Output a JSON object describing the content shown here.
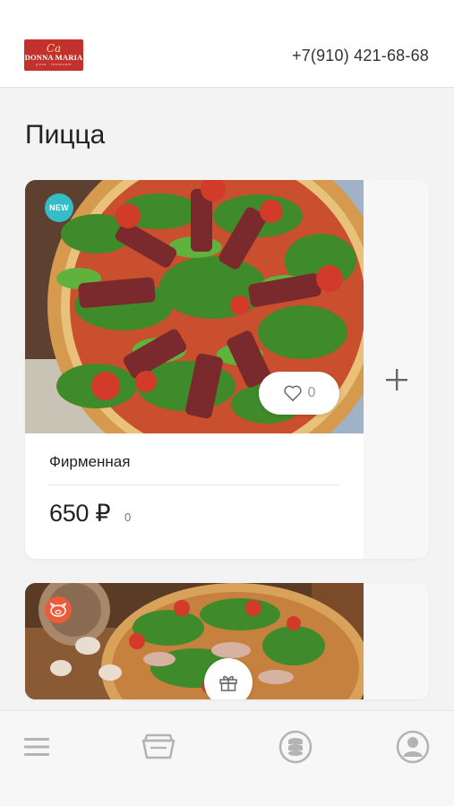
{
  "header": {
    "logo": {
      "top": "Сa",
      "name": "DONNA MARIA",
      "sub": "pizza · restaurant"
    },
    "phone": "+7(910) 421-68-68"
  },
  "page": {
    "title": "Пицца"
  },
  "products": [
    {
      "name": "Фирменная",
      "price": "650 ₽",
      "bonus": "0",
      "likes": "0",
      "badge": "NEW",
      "image": "pizza-arugula-bresaola-image"
    },
    {
      "badge": "pig-icon",
      "image": "pizza-ham-mushrooms-image"
    }
  ],
  "tabbar": {
    "items": [
      "menu-icon",
      "basket-icon",
      "bonus-coins-icon",
      "profile-icon"
    ]
  },
  "colors": {
    "brand": "#c4302b",
    "new_badge": "#35bdc7",
    "pig_badge": "#ec5b3b",
    "background": "#f3f3f3"
  }
}
